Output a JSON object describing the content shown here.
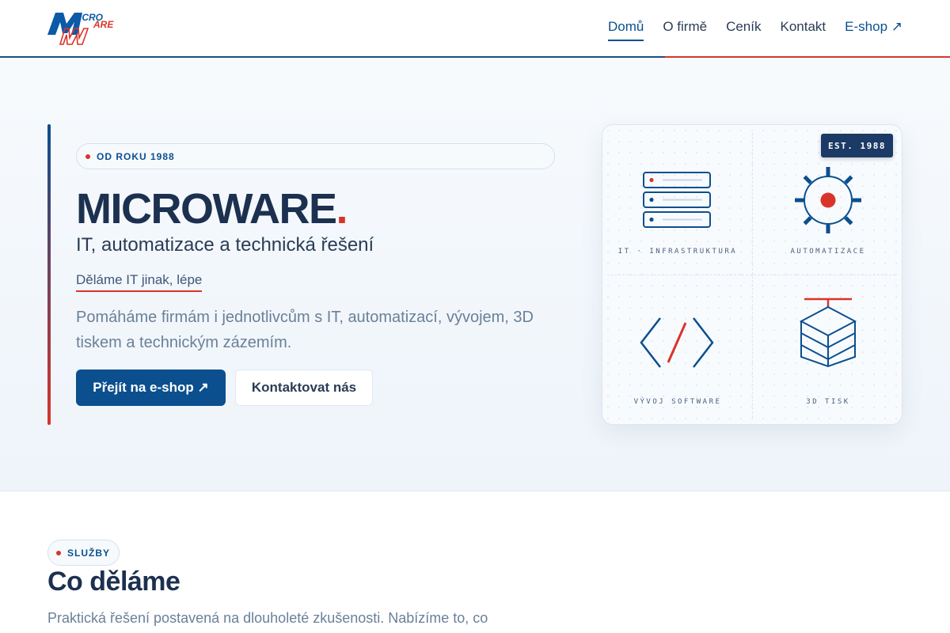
{
  "header": {
    "logo_text_top": "ICRO",
    "logo_text_bottom": "ARE",
    "nav": [
      {
        "label": "Domů",
        "active": true
      },
      {
        "label": "O firmě"
      },
      {
        "label": "Ceník"
      },
      {
        "label": "Kontakt"
      },
      {
        "label": "E-shop ↗"
      }
    ]
  },
  "hero": {
    "badge": "OD ROKU 1988",
    "title": "MICROWARE",
    "title_dot": ".",
    "subtitle": "IT, automatizace a technická řešení",
    "tagline": "Děláme IT jinak, lépe",
    "description": "Pomáháme firmám i jednotlivcům s IT, automatizací, vývojem, 3D tiskem a technickým zázemím.",
    "primary_button": "Přejít na e-shop ↗",
    "secondary_button": "Kontaktovat nás"
  },
  "card": {
    "est_badge": "EST. 1988",
    "cells": [
      {
        "label": "IT · INFRASTRUKTURA",
        "icon": "server-icon"
      },
      {
        "label": "AUTOMATIZACE",
        "icon": "gear-icon"
      },
      {
        "label": "VÝVOJ SOFTWARE",
        "icon": "code-icon"
      },
      {
        "label": "3D TISK",
        "icon": "layers-icon"
      }
    ]
  },
  "services": {
    "badge": "SLUŽBY",
    "title": "Co děláme",
    "description": "Praktická řešení postavená na dlouholeté zkušenosti. Nabízíme to, co"
  },
  "colors": {
    "primary": "#0b4f8e",
    "accent": "#d9342b",
    "dark": "#1c3050"
  }
}
